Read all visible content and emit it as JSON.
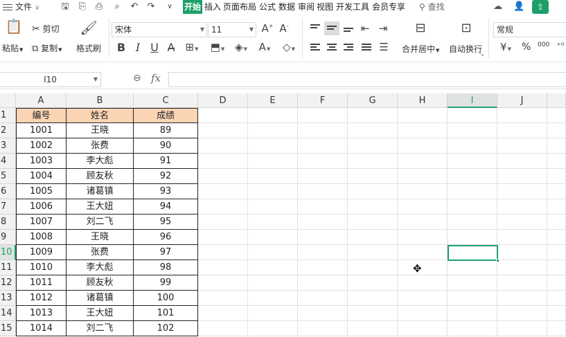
{
  "menu": {
    "file_label": "文件",
    "tabs": [
      "开始",
      "插入",
      "页面布局",
      "公式",
      "数据",
      "审阅",
      "视图",
      "开发工具",
      "会员专享"
    ],
    "search_label": "查找"
  },
  "ribbon": {
    "paste": "粘贴",
    "cut": "剪切",
    "copy": "复制",
    "format_painter": "格式刷",
    "font_name": "宋体",
    "font_size": "11",
    "merge_center": "合并居中",
    "wrap_text": "自动换行",
    "number_format": "常规",
    "percent": "%",
    "thousands": "000"
  },
  "formula_bar": {
    "name_box": "I10",
    "fx_label": "fx",
    "formula": ""
  },
  "sheet": {
    "columns": [
      "A",
      "B",
      "C",
      "D",
      "E",
      "F",
      "G",
      "H",
      "I",
      "J"
    ],
    "rows": [
      "1",
      "2",
      "3",
      "4",
      "5",
      "6",
      "7",
      "8",
      "9",
      "10",
      "11",
      "12",
      "13",
      "14",
      "15"
    ],
    "header": [
      "编号",
      "姓名",
      "成绩"
    ],
    "data": [
      [
        "1001",
        "王晓",
        "89"
      ],
      [
        "1002",
        "张费",
        "90"
      ],
      [
        "1003",
        "李大彪",
        "91"
      ],
      [
        "1004",
        "顾友秋",
        "92"
      ],
      [
        "1005",
        "诸葛镇",
        "93"
      ],
      [
        "1006",
        "王大妞",
        "94"
      ],
      [
        "1007",
        "刘二飞",
        "95"
      ],
      [
        "1008",
        "王晓",
        "96"
      ],
      [
        "1009",
        "张费",
        "97"
      ],
      [
        "1010",
        "李大彪",
        "98"
      ],
      [
        "1011",
        "顾友秋",
        "99"
      ],
      [
        "1012",
        "诸葛镇",
        "100"
      ],
      [
        "1013",
        "王大妞",
        "101"
      ],
      [
        "1014",
        "刘二飞",
        "102"
      ]
    ],
    "selected_column": "I",
    "selected_row": "10"
  },
  "colors": {
    "accent": "#1e9f6a",
    "header_fill": "#fbd4b4"
  }
}
